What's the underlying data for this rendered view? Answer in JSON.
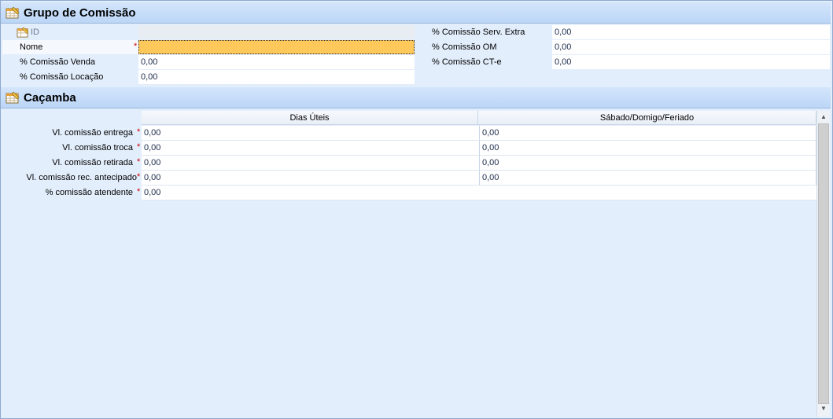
{
  "sections": {
    "grupo": {
      "title": "Grupo de Comissão",
      "icon": "table-edit-icon"
    },
    "cacamba": {
      "title": "Caçamba",
      "icon": "table-edit-icon"
    }
  },
  "grupo_form": {
    "id_label": "ID",
    "id_value": "",
    "nome_label": "Nome",
    "nome_value": "",
    "venda_label": "% Comissão Venda",
    "venda_value": "0,00",
    "locacao_label": "% Comissão Locação",
    "locacao_value": "0,00",
    "serv_extra_label": "% Comissão Serv. Extra",
    "serv_extra_value": "0,00",
    "om_label": "% Comissão OM",
    "om_value": "0,00",
    "cte_label": "% Comissão CT-e",
    "cte_value": "0,00",
    "required_mark": "*"
  },
  "cacamba_grid": {
    "columns": [
      "Dias Úteis",
      "Sábado/Domigo/Feriado"
    ],
    "rows": [
      {
        "label": "Vl. comissão entrega",
        "dias": "0,00",
        "sabado": "0,00"
      },
      {
        "label": "Vl. comissão troca",
        "dias": "0,00",
        "sabado": "0,00"
      },
      {
        "label": "Vl. comissão retirada",
        "dias": "0,00",
        "sabado": "0,00"
      },
      {
        "label": "Vl. comissão rec. antecipado",
        "dias": "0,00",
        "sabado": "0,00"
      },
      {
        "label": "% comissão atendente",
        "dias": "0,00"
      }
    ],
    "required_mark": "*"
  },
  "colors": {
    "required": "#cc0000",
    "focus_field": "#ffc85a",
    "header_bg": "#c6dcf8",
    "panel_bg": "#e3eefc"
  }
}
